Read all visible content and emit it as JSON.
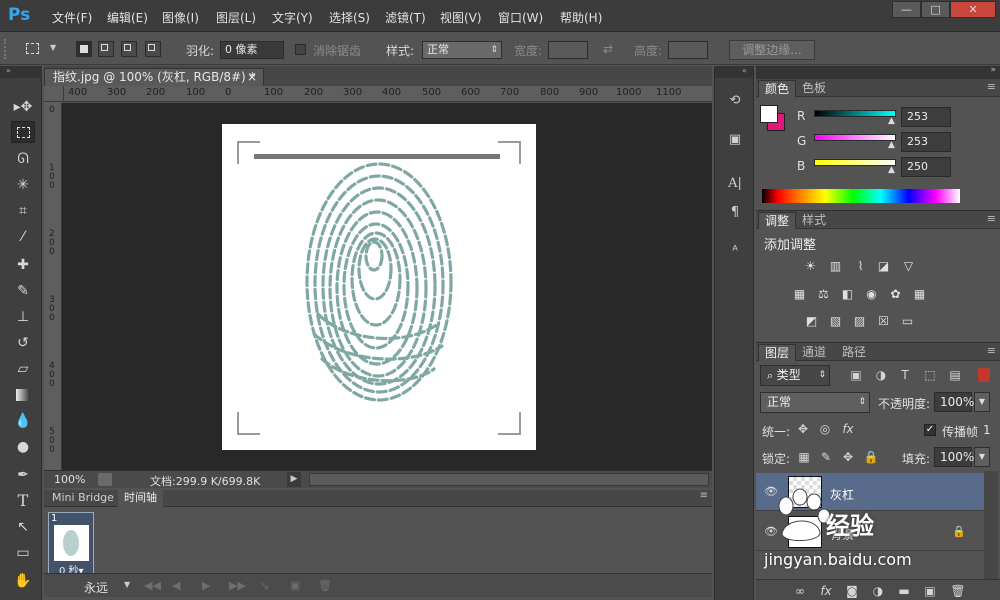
{
  "app": {
    "logo": "Ps"
  },
  "menu": [
    "文件(F)",
    "编辑(E)",
    "图像(I)",
    "图层(L)",
    "文字(Y)",
    "选择(S)",
    "滤镜(T)",
    "视图(V)",
    "窗口(W)",
    "帮助(H)"
  ],
  "window_controls": {
    "minimize": "—",
    "restore": "□",
    "close": "✕"
  },
  "options": {
    "feather_label": "羽化:",
    "feather_value": "0 像素",
    "antialias_label": "消除锯齿",
    "style_label": "样式:",
    "style_value": "正常",
    "width_label": "宽度:",
    "height_label": "高度:",
    "refine_button": "调整边缘..."
  },
  "document": {
    "tab_title": "指纹.jpg @ 100% (灰杠, RGB/8#) *",
    "close": "×",
    "ruler_h": [
      "400",
      "300",
      "200",
      "100",
      "0",
      "100",
      "200",
      "300",
      "400",
      "500",
      "600",
      "700",
      "800",
      "900",
      "1000",
      "1100"
    ],
    "ruler_v": [
      "0",
      "1 0 0",
      "2 0 0",
      "3 0 0",
      "4 0 0",
      "5 0 0"
    ],
    "zoom": "100%",
    "doc_info": "文档:299.9 K/699.8K"
  },
  "timeline": {
    "tabs": [
      "Mini Bridge",
      "时间轴"
    ],
    "frame_number": "1",
    "frame_delay": "0 秒▾",
    "loop": "永远"
  },
  "color_panel": {
    "tabs": [
      "颜色",
      "色板"
    ],
    "foreground": "#ffffff",
    "background": "#e0187a",
    "channels": [
      {
        "label": "R",
        "value": "253",
        "from": "#000000",
        "to": "#00ffff"
      },
      {
        "label": "G",
        "value": "253",
        "from": "#ff00ff",
        "to": "#ffffff"
      },
      {
        "label": "B",
        "value": "250",
        "from": "#ffff00",
        "to": "#ffffff"
      }
    ]
  },
  "adjust_panel": {
    "tabs": [
      "调整",
      "样式"
    ],
    "title": "添加调整"
  },
  "layers_panel": {
    "tabs": [
      "图层",
      "通道",
      "路径"
    ],
    "filter": "类型",
    "blend_mode": "正常",
    "opacity_label": "不透明度:",
    "opacity_value": "100%",
    "unify_label": "统一:",
    "propagate_label": "传播帧",
    "propagate_value": "1",
    "lock_label": "锁定:",
    "fill_label": "填充:",
    "fill_value": "100%",
    "layers": [
      {
        "name": "灰杠"
      },
      {
        "name": "背景"
      }
    ]
  },
  "watermark": {
    "brand": "Baidu",
    "text": "经验",
    "url": "jingyan.baidu.com"
  }
}
